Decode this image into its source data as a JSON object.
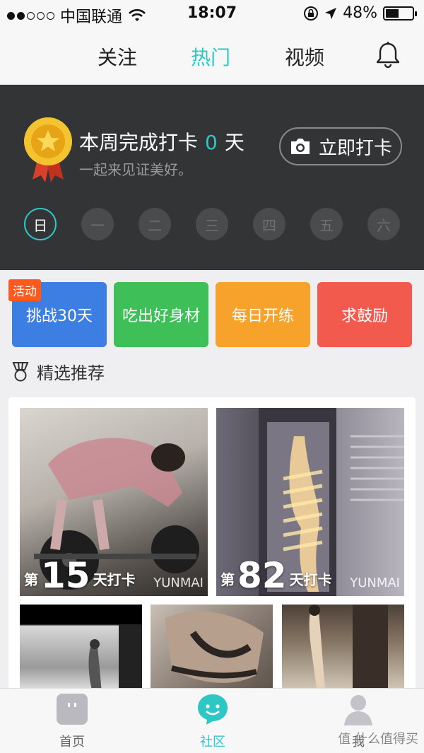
{
  "status": {
    "carrier": "中国联通",
    "time": "18:07",
    "battery": "48%"
  },
  "topnav": {
    "tabs": [
      "关注",
      "热门",
      "视频"
    ],
    "active": "热门"
  },
  "hero": {
    "title_prefix": "本周完成打卡",
    "count": "0",
    "unit": "天",
    "subtitle": "一起来见证美好。",
    "checkin_label": "立即打卡",
    "days": [
      "日",
      "一",
      "二",
      "三",
      "四",
      "五",
      "六"
    ]
  },
  "activities": {
    "badge": "活动",
    "items": [
      {
        "label": "挑战30天",
        "color": "#3d7ee3"
      },
      {
        "label": "吃出好身材",
        "color": "#3fbf58"
      },
      {
        "label": "每日开练",
        "color": "#f7a22b"
      },
      {
        "label": "求鼓励",
        "color": "#f35a4e"
      }
    ]
  },
  "featured": {
    "title": "精选推荐"
  },
  "posts": [
    {
      "prefix": "第",
      "days": "15",
      "suffix": "天打卡",
      "watermark": "YUNMAI"
    },
    {
      "prefix": "第",
      "days": "82",
      "suffix": "天打卡",
      "watermark": "YUNMAI"
    }
  ],
  "bottom_nav": {
    "items": [
      "首页",
      "社区",
      "我"
    ],
    "active": "社区"
  },
  "watermark_site": "值 什么值得买"
}
